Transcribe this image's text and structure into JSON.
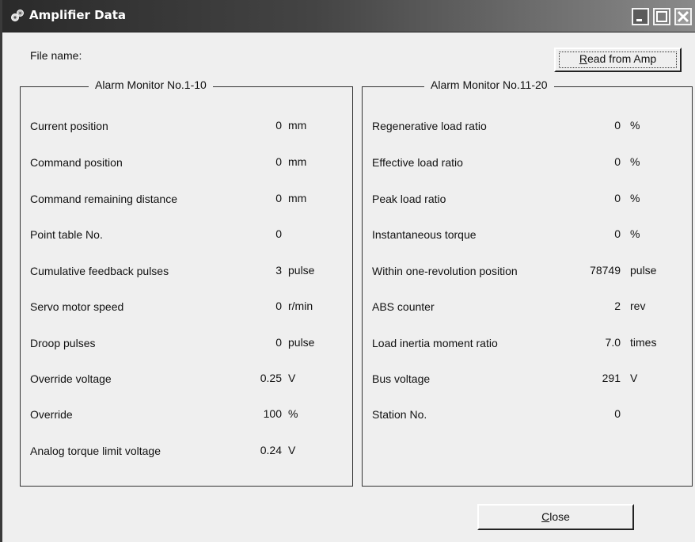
{
  "window": {
    "title": "Amplifier Data",
    "icon": "amplifier-app-icon",
    "controls": [
      "minimize-icon",
      "maximize-icon",
      "close-icon"
    ]
  },
  "file": {
    "label": "File name:",
    "value": ""
  },
  "read_button": {
    "label": "Read from Amp",
    "mnemonic": "R"
  },
  "close_button": {
    "label": "Close",
    "mnemonic": "C"
  },
  "left_group": {
    "title": "Alarm Monitor No.1-10",
    "rows": [
      {
        "label": "Current position",
        "value": "0",
        "unit": "mm"
      },
      {
        "label": "Command position",
        "value": "0",
        "unit": "mm"
      },
      {
        "label": "Command remaining distance",
        "value": "0",
        "unit": "mm"
      },
      {
        "label": "Point table No.",
        "value": "0",
        "unit": ""
      },
      {
        "label": "Cumulative feedback pulses",
        "value": "3",
        "unit": "pulse"
      },
      {
        "label": "Servo motor speed",
        "value": "0",
        "unit": "r/min"
      },
      {
        "label": "Droop pulses",
        "value": "0",
        "unit": "pulse"
      },
      {
        "label": "Override voltage",
        "value": "0.25",
        "unit": "V"
      },
      {
        "label": "Override",
        "value": "100",
        "unit": "%"
      },
      {
        "label": "Analog torque limit voltage",
        "value": "0.24",
        "unit": "V"
      }
    ]
  },
  "right_group": {
    "title": "Alarm Monitor No.11-20",
    "rows": [
      {
        "label": "Regenerative load ratio",
        "value": "0",
        "unit": "%"
      },
      {
        "label": "Effective load ratio",
        "value": "0",
        "unit": "%"
      },
      {
        "label": "Peak load ratio",
        "value": "0",
        "unit": "%"
      },
      {
        "label": "Instantaneous torque",
        "value": "0",
        "unit": "%"
      },
      {
        "label": "Within one-revolution position",
        "value": "78749",
        "unit": "pulse"
      },
      {
        "label": "ABS counter",
        "value": "2",
        "unit": "rev"
      },
      {
        "label": "Load inertia moment ratio",
        "value": "7.0",
        "unit": "times"
      },
      {
        "label": "Bus voltage",
        "value": "291",
        "unit": "V"
      },
      {
        "label": "Station No.",
        "value": "0",
        "unit": ""
      }
    ]
  }
}
